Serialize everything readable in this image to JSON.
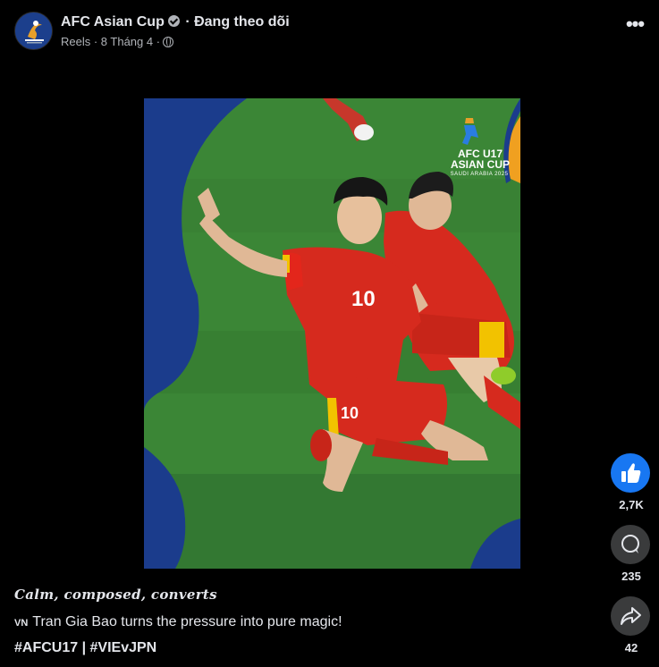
{
  "header": {
    "page_name": "AFC Asian Cup",
    "follow_label": "· Đang theo dõi",
    "meta_text": "Reels · 8 Tháng 4 ·",
    "more_label": "•••"
  },
  "video": {
    "logo_line1": "AFC U17",
    "logo_line2": "ASIAN CUP",
    "logo_sub": "SAUDI ARABIA 2025"
  },
  "actions": {
    "like_count": "2,7K",
    "comment_count": "235",
    "share_count": "42"
  },
  "caption": {
    "line1": "Calm, composed, converts",
    "flag": "VN",
    "line2": "Tran Gia Bao turns the pressure into pure magic!",
    "hashtag1": "#AFCU17",
    "separator": " | ",
    "hashtag2": "#VIEvJPN"
  },
  "colors": {
    "background": "#000000",
    "like_blue": "#1877f2",
    "button_gray": "#3a3b3c",
    "text_primary": "#e4e6eb",
    "text_secondary": "#b0b3b8",
    "pitch_green": "#357d31",
    "jersey_red": "#d62a1e"
  }
}
